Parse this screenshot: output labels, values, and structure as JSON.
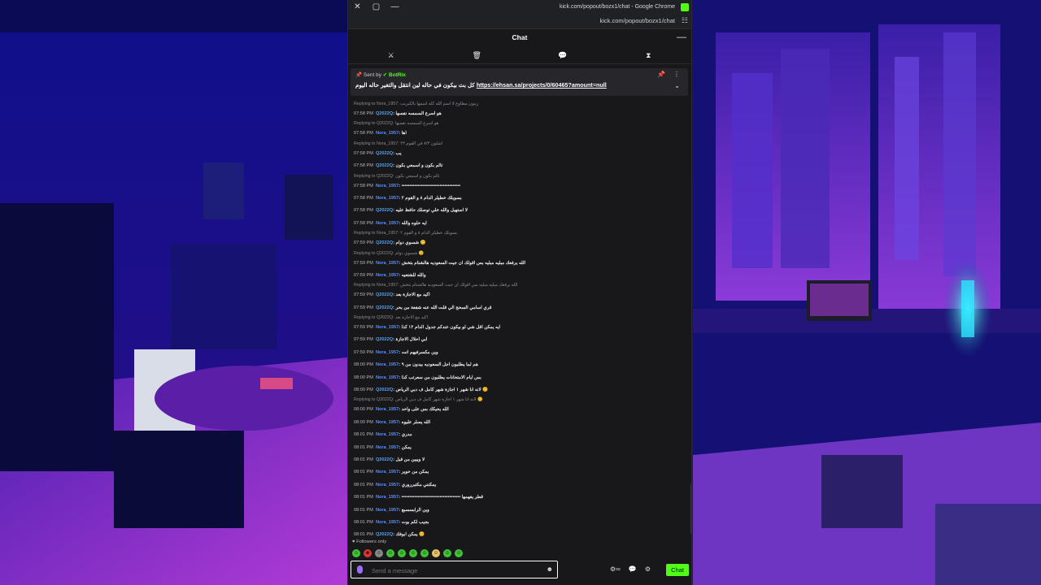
{
  "window": {
    "title": "kick.com/popout/bozx1/chat - Google Chrome",
    "url": "kick.com/popout/bozx1/chat",
    "close_icon": "close-icon",
    "maximize_icon": "maximize-icon",
    "minimize_icon": "minimize-icon"
  },
  "chat": {
    "header": "Chat",
    "minimize": "—",
    "pinned": {
      "sent_by_prefix": "Sent by",
      "bot": "BotRix",
      "message_arabic": "كل بث بيكون في حاله لين انتقل والتغير حاله اليوم",
      "link": "https://ehsan.sa/projects/0/60465?amount=null"
    },
    "messages": [
      {
        "reply": "Replying to Nora_1957: زينون مطاوع لا اسم الله كله اسمها بالكبريت",
        "time": "07:58 PM",
        "user": "Q2022Q",
        "text": "هو اسرع السمسه نفسها"
      },
      {
        "reply": "Replying to Q2022Q: هو اسرع السمسه نفسها",
        "time": "07:58 PM",
        "user": "Nora_1957",
        "text": "اها"
      },
      {
        "reply": "Replying to Nora_1957: اشلون ٨/٣ في القوم ٢٣",
        "time": "07:58 PM",
        "user": "Q2022Q",
        "text": "يب"
      },
      {
        "reply": "",
        "time": "07:58 PM",
        "user": "Q2022Q",
        "text": "تالم بكون و اسمعي بكون"
      },
      {
        "reply": "Replying to Q2022Q: تالم بكون و اسمعي بكون",
        "time": "07:58 PM",
        "user": "Nora_1957",
        "text": "•••••••••••••••••••••••••••••••••••••"
      },
      {
        "reply": "",
        "time": "07:58 PM",
        "user": "Nora_1957",
        "text": "بسويلك خطيلر الدام ٨ و القوم ٢"
      },
      {
        "reply": "",
        "time": "07:58 PM",
        "user": "Q2022Q",
        "text": "لا استهبل والله خلي توصلك حافظ عليه"
      },
      {
        "reply": "",
        "time": "07:58 PM",
        "user": "Nora_1957",
        "text": "ايه حلوه والله"
      },
      {
        "reply": "Replying to Nora_1957: بسويلك خطيلر الدام ٨ و القوم ٢",
        "time": "07:59 PM",
        "user": "Q2022Q",
        "text": "شسوي دوام 😊"
      },
      {
        "reply": "Replying to Q2022Q: شسوي دوام 😊",
        "time": "07:59 PM",
        "user": "Nora_1957",
        "text": "الله يرفعك مبليه مبليه بس اقولك ان جيت السعوديه هالشتام بتخش"
      },
      {
        "reply": "",
        "time": "07:59 PM",
        "user": "Nora_1957",
        "text": "والله للشتعيه"
      },
      {
        "reply": "Replying to Nora_1957: الله يرفعك مبليه مبليه بس اقولك ان جيت السعوديه هالشتام بتخش",
        "time": "07:59 PM",
        "user": "Q2022Q",
        "text": "اكيد مع الاجازة بعد"
      },
      {
        "reply": "",
        "time": "07:59 PM",
        "user": "Q2022Q",
        "text": "قري اسامي السحج الي قلت الله عنه شفعة من بحر"
      },
      {
        "reply": "Replying to Q2022Q: اكيد مع الاجازة بعد",
        "time": "07:59 PM",
        "user": "Nora_1957",
        "text": "ايه يمكن اقل شي لو بيكون عندكم جدول الدام ١٢ كذا"
      },
      {
        "reply": "",
        "time": "07:59 PM",
        "user": "Q2022Q",
        "text": "ابي احلال الاجازة"
      },
      {
        "reply": "",
        "time": "07:59 PM",
        "user": "Nora_1957",
        "text": "وين مكسرفيهم انت"
      },
      {
        "reply": "",
        "time": "08:00 PM",
        "user": "Nora_1957",
        "text": "هم لما يطلبون اجل السعوديه بيدون من ٩"
      },
      {
        "reply": "",
        "time": "08:00 PM",
        "user": "Nora_1957",
        "text": "بس ايام الامتحانات يطلبون من سعرتب كذا"
      },
      {
        "reply": "",
        "time": "08:00 PM",
        "user": "Q2022Q",
        "text": "لانه انا شهر ١ اجازة شهر كامل ف دبي الرياض 😊"
      },
      {
        "reply": "Replying to Q2022Q: لانه انا شهر ١ اجازة شهر كامل ف دبي الرياض 😊",
        "time": "08:00 PM",
        "user": "Nora_1957",
        "text": "الله يحيكك بس على واحد"
      },
      {
        "reply": "",
        "time": "08:00 PM",
        "user": "Nora_1957",
        "text": "الله يسلر عليوه"
      },
      {
        "reply": "",
        "time": "08:01 PM",
        "user": "Nora_1957",
        "text": "مدري"
      },
      {
        "reply": "",
        "time": "08:01 PM",
        "user": "Nora_1957",
        "text": "يمكن"
      },
      {
        "reply": "",
        "time": "08:01 PM",
        "user": "Q2022Q",
        "text": "لا ويبين من قبل"
      },
      {
        "reply": "",
        "time": "08:01 PM",
        "user": "Nora_1957",
        "text": "يمكن من حوير"
      },
      {
        "reply": "",
        "time": "08:01 PM",
        "user": "Nora_1957",
        "text": "يمكنني مكتبرروري"
      },
      {
        "reply": "",
        "time": "08:01 PM",
        "user": "Nora_1957",
        "text": "••••••••••••••••••••••••••••••••••••• قطر يفهمها"
      },
      {
        "reply": "",
        "time": "08:01 PM",
        "user": "Nora_1957",
        "text": "وين الرابسسبع"
      },
      {
        "reply": "",
        "time": "08:01 PM",
        "user": "Nora_1957",
        "text": "بجيب لكم بوت"
      },
      {
        "reply": "",
        "time": "08:01 PM",
        "user": "Q2022Q",
        "text": "يمكن ابوفك 😊"
      }
    ],
    "followers_only": "Followers only",
    "input_placeholder": "Send a message",
    "send_label": "Chat"
  },
  "colors": {
    "accent": "#53fc18",
    "panel": "#18181b",
    "username_nora": "#5b8ff9",
    "username_q": "#4fa2f5"
  }
}
